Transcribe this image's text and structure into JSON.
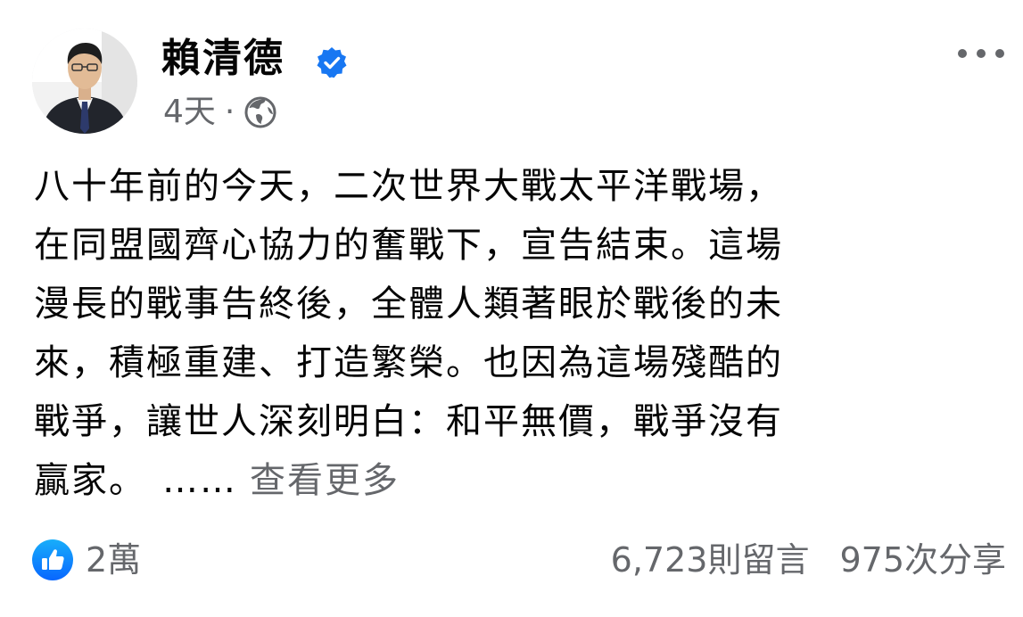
{
  "post": {
    "author": "賴清德",
    "time": "4天",
    "separator": "·",
    "text_lines": [
      "八十年前的今天，二次世界大戰太平洋戰場，",
      "在同盟國齊心協力的奮戰下，宣告結束。這場",
      "漫長的戰事告終後，全體人類著眼於戰後的未",
      "來，積極重建、打造繁榮。也因為這場殘酷的",
      "戰爭，讓世人深刻明白：和平無價，戰爭沒有",
      "贏家。"
    ],
    "ellipsis": "……",
    "see_more": "查看更多"
  },
  "footer": {
    "reactions": "2萬",
    "comments": "6,723則留言",
    "shares": "975次分享"
  },
  "icons": {
    "verified": "verified-badge-icon",
    "audience": "globe-icon",
    "more": "more-options-icon",
    "reaction": "like-icon"
  },
  "colors": {
    "brand_blue": "#1877f2",
    "secondary_text": "#65676b",
    "primary_text": "#050505"
  }
}
